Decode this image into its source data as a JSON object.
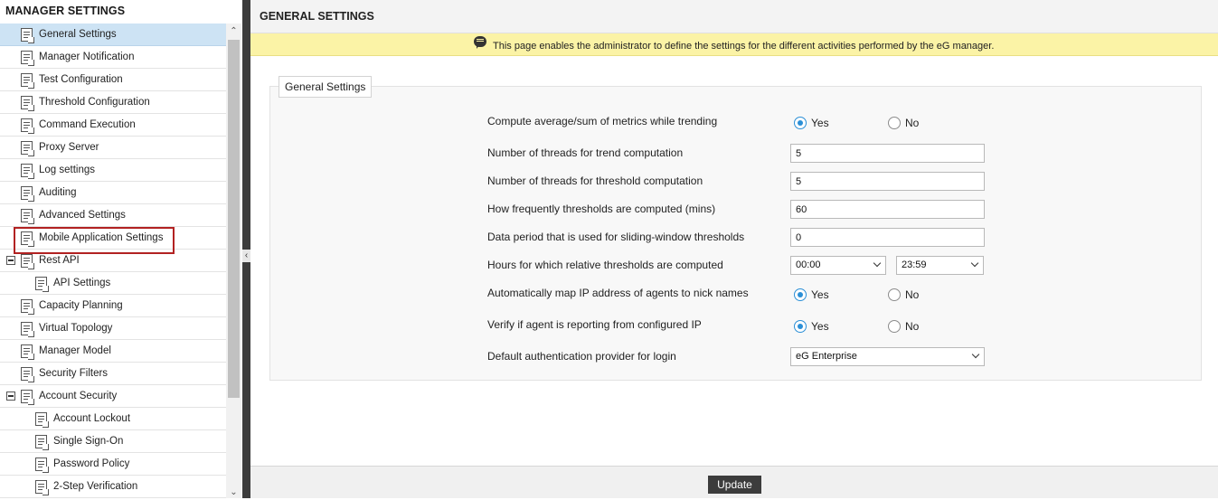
{
  "sidebar": {
    "title": "MANAGER SETTINGS",
    "items": [
      {
        "label": "General Settings"
      },
      {
        "label": "Manager Notification"
      },
      {
        "label": "Test Configuration"
      },
      {
        "label": "Threshold Configuration"
      },
      {
        "label": "Command Execution"
      },
      {
        "label": "Proxy Server"
      },
      {
        "label": "Log settings"
      },
      {
        "label": "Auditing"
      },
      {
        "label": "Advanced Settings"
      },
      {
        "label": "Mobile Application Settings"
      },
      {
        "label": "Rest API"
      },
      {
        "label": "API Settings"
      },
      {
        "label": "Capacity Planning"
      },
      {
        "label": "Virtual Topology"
      },
      {
        "label": "Manager Model"
      },
      {
        "label": "Security Filters"
      },
      {
        "label": "Account Security"
      },
      {
        "label": "Account Lockout"
      },
      {
        "label": "Single Sign-On"
      },
      {
        "label": "Password Policy"
      },
      {
        "label": "2-Step Verification"
      }
    ],
    "selected": "General Settings",
    "highlighted": "Mobile Application Settings",
    "scroll_up_glyph": "⌃",
    "scroll_down_glyph": "⌄",
    "collapse_glyph": "‹"
  },
  "main": {
    "title": "GENERAL SETTINGS",
    "info_text": "This page enables the administrator to define the settings for the different activities performed by the eG manager.",
    "section_legend": "General Settings",
    "fields": {
      "compute_avg_label": "Compute average/sum of metrics while trending",
      "compute_avg_value": "Yes",
      "trend_threads_label": "Number of threads for trend computation",
      "trend_threads_value": "5",
      "threshold_threads_label": "Number of threads for threshold computation",
      "threshold_threads_value": "5",
      "threshold_freq_label": "How frequently thresholds are computed (mins)",
      "threshold_freq_value": "60",
      "sliding_period_label": "Data period that is used for sliding-window thresholds",
      "sliding_period_value": "0",
      "relative_hours_label": "Hours for which relative thresholds are computed",
      "relative_hours_from": "00:00",
      "relative_hours_to": "23:59",
      "map_ip_label": "Automatically map IP address of agents to nick names",
      "map_ip_value": "Yes",
      "verify_ip_label": "Verify if agent is reporting from configured IP",
      "verify_ip_value": "Yes",
      "auth_provider_label": "Default authentication provider for login",
      "auth_provider_value": "eG Enterprise"
    },
    "radio_yes": "Yes",
    "radio_no": "No",
    "update_button": "Update"
  },
  "colors": {
    "selected_row": "#cde3f4",
    "highlight_border": "#b22222",
    "info_bar": "#fbf3a6",
    "radio_accent": "#2b8fd6",
    "update_button": "#3c3c3c"
  }
}
